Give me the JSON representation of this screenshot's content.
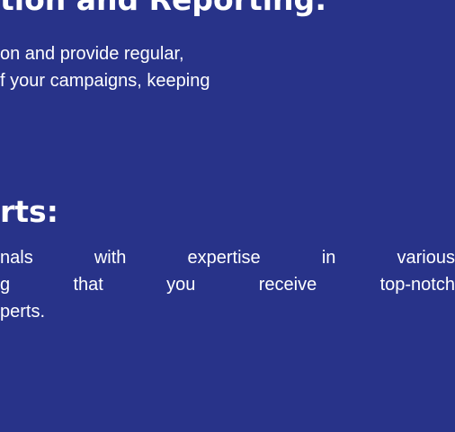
{
  "colors": {
    "background": "#283389",
    "text": "#ffffff"
  },
  "section1": {
    "title": "tion and Reporting:",
    "lines": [
      "on and provide regular,",
      "f your campaigns, keeping"
    ]
  },
  "section2": {
    "title": "rts:",
    "line1_words": [
      "nals",
      "with",
      "expertise",
      "in",
      "various"
    ],
    "line2_words": [
      "g",
      "that",
      "you",
      "receive",
      "top-notch"
    ],
    "line3": "perts."
  }
}
